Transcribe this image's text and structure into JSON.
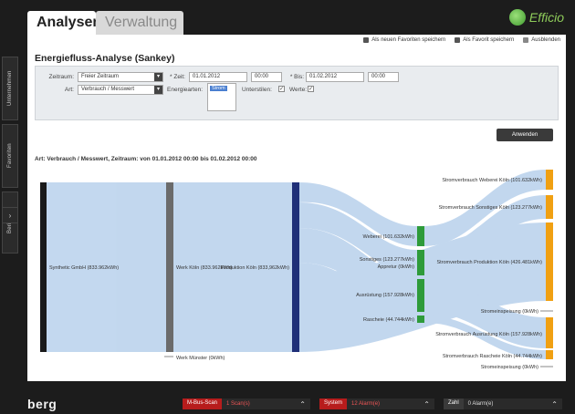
{
  "side_tabs": [
    "Unternehmen",
    "Favoriten",
    "Berichte"
  ],
  "tabs": {
    "active": "Analysen",
    "inactive": "Verwaltung"
  },
  "logo_text": "Efficio",
  "toolbar": {
    "save_new_fav": "Als neuen Favoriten speichern",
    "save_fav": "Als Favorit speichern",
    "hide": "Ausblenden"
  },
  "page_title": "Energiefluss-Analyse (Sankey)",
  "filter": {
    "zeitraum_label": "Zeitraum:",
    "zeitraum_value": "Freier Zeitraum",
    "zeit_label": "* Zeit:",
    "zeit_date": "01.01.2012",
    "zeit_time": "00:00",
    "bis_label": "* Bis:",
    "bis_date": "01.02.2012",
    "bis_time": "00:00",
    "art_label": "Art:",
    "art_value": "Verbrauch / Messwert",
    "energiearten_label": "Energiearten:",
    "energiearten_selected": "Strom",
    "unterstilen_label": "Unterstilen:",
    "werte_label": "Werte:"
  },
  "apply_label": "Anwenden",
  "subtitle": "Art: Verbrauch / Messwert, Zeitraum: von 01.01.2012 00:00 bis 01.02.2012 00:00",
  "sankey": {
    "level1": "Synthetic GmbH (833.962kWh)",
    "level2a": "Werk Köln (833.962kWh)",
    "level2b": "Werk Münster (0kWh)",
    "level3": "Produktion Köln (833,962kWh)",
    "mid": [
      "Weberei (101.632kWh)",
      "Sonstiges (123.277kWh)",
      "Appretur (0kWh)",
      "Ausrüstung (157.928kWh)",
      "Rascheie (44.744kWh)"
    ],
    "right": [
      "Stromverbrauch Weberei Köln (101.632kWh)",
      "Stromverbrauch Sonstiges Köln (123.277kWh)",
      "Stromverbrauch Produktion Köln (426.481kWh)",
      "Stromeinspeisung (0kWh)",
      "Stromverbrauch Ausrüstung Köln (157.928kWh)",
      "Stromverbrauch Rascheie Köln (44.744kWh)",
      "Stromeinspeisung (0kWh)"
    ],
    "colors": {
      "black": "#1a1a1a",
      "grey": "#6b6b6b",
      "navy": "#1f2f78",
      "green": "#2e9b3a",
      "orange": "#f0a012",
      "flow": "#b8d1ec"
    }
  },
  "bottom": {
    "brand": "berg",
    "s1_key": "M-Bus-Scan",
    "s1_val": "1 Scan(s)",
    "s2_key": "System",
    "s2_val": "12 Alarm(e)",
    "s3_key": "Zahl",
    "s3_val": "0 Alarm(e)"
  }
}
